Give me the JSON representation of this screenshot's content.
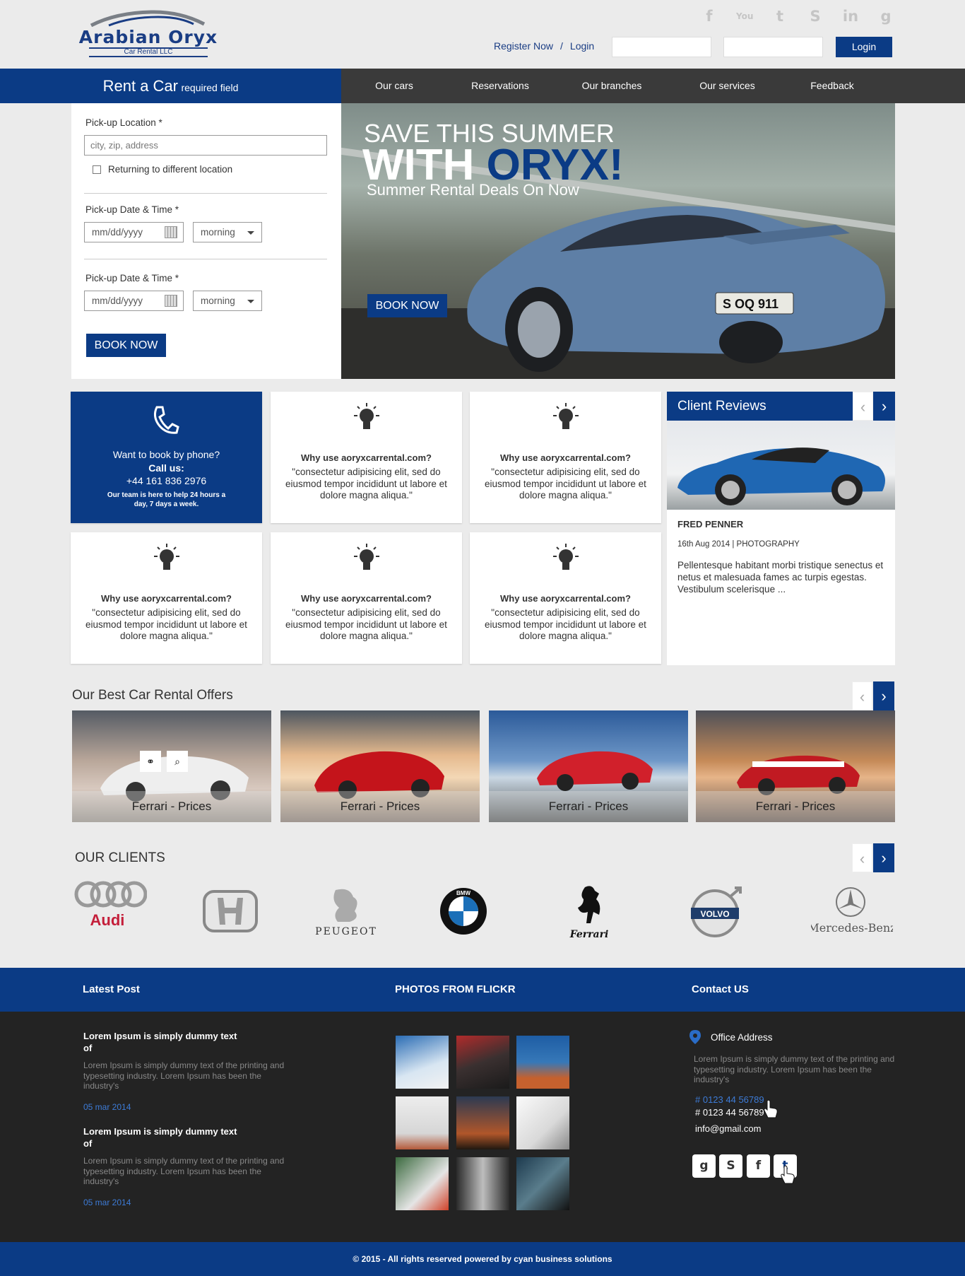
{
  "header": {
    "logo_name": "Arabian Oryx",
    "logo_sub": "Car Rental LLC",
    "social_icons": [
      "facebook-icon",
      "youtube-icon",
      "twitter-icon",
      "skype-icon",
      "linkedin-icon",
      "google-plus-icon"
    ],
    "register_label": "Register Now",
    "separator": "/",
    "login_link": "Login",
    "login_button": "Login"
  },
  "nav": {
    "rent_title": "Rent a Car",
    "rent_note": "required field",
    "items": [
      "Our cars",
      "Reservations",
      "Our branches",
      "Our services",
      "Feedback"
    ]
  },
  "form": {
    "pickup_location_label": "Pick-up Location *",
    "pickup_location_placeholder": "city, zip, address",
    "return_checkbox": "Returning to different location",
    "datetime_label_1": "Pick-up Date & Time *",
    "date_placeholder_1": "mm/dd/yyyy",
    "time_value_1": "morning",
    "datetime_label_2": "Pick-up Date & Time *",
    "date_placeholder_2": "mm/dd/yyyy",
    "time_value_2": "morning",
    "book_button": "BOOK NOW"
  },
  "hero": {
    "line1": "SAVE THIS SUMMER",
    "line2a": "WITH",
    "line2b": "ORYX!",
    "line3": "Summer Rental Deals On Now",
    "book_button": "BOOK NOW",
    "plate": "S OQ 911"
  },
  "phone_card": {
    "title": "Want to book by phone?",
    "call": "Call us:",
    "number": "+44 161 836 2976",
    "note": "Our team is here to help 24 hours a day, 7 days a week."
  },
  "features": [
    {
      "title": "Why use aoryxcarrental.com?",
      "quote": "\"consectetur adipisicing elit, sed do eiusmod tempor incididunt ut labore et dolore magna aliqua.\""
    },
    {
      "title": "Why use aoryxcarrental.com?",
      "quote": "\"consectetur adipisicing elit, sed do eiusmod tempor incididunt ut labore et dolore magna aliqua.\""
    },
    {
      "title": "Why use aoryxcarrental.com?",
      "quote": "\"consectetur adipisicing elit, sed do eiusmod tempor incididunt ut labore et dolore magna aliqua.\""
    },
    {
      "title": "Why use aoryxcarrental.com?",
      "quote": "\"consectetur adipisicing elit, sed do eiusmod tempor incididunt ut labore et dolore magna aliqua.\""
    },
    {
      "title": "Why use aoryxcarrental.com?",
      "quote": "\"consectetur adipisicing elit, sed do eiusmod tempor incididunt ut labore et dolore magna aliqua.\""
    }
  ],
  "reviews": {
    "title": "Client Reviews",
    "name": "FRED PENNER",
    "date": "16th Aug 2014 | PHOTOGRAPHY",
    "text": "Pellentesque habitant morbi tristique senectus et netus et malesuada fames ac turpis egestas. Vestibulum scelerisque ..."
  },
  "offers": {
    "title": "Our Best Car Rental Offers",
    "items": [
      "Ferrari - Prices",
      "Ferrari - Prices",
      "Ferrari - Prices",
      "Ferrari - Prices"
    ]
  },
  "clients": {
    "title": "OUR CLIENTS",
    "brands": [
      "Audi",
      "HONDA",
      "PEUGEOT",
      "BMW",
      "Ferrari",
      "VOLVO",
      "Mercedes-Benz"
    ]
  },
  "footer": {
    "latest_title": "Latest Post",
    "flickr_title": "PHOTOS FROM FLICKR",
    "contact_title": "Contact US",
    "posts": [
      {
        "title": "Lorem Ipsum is simply dummy text of",
        "text": "Lorem Ipsum is simply dummy text of the printing and typesetting industry. Lorem Ipsum has been the industry's",
        "date": "05 mar 2014"
      },
      {
        "title": "Lorem Ipsum is simply dummy text of",
        "text": "Lorem Ipsum is simply dummy text of the printing and typesetting industry. Lorem Ipsum has been the industry's",
        "date": "05 mar 2014"
      }
    ],
    "office_label": "Office Address",
    "office_text": "Lorem Ipsum is simply dummy text of the printing and typesetting industry. Lorem Ipsum has been the industry's",
    "phone1": "# 0123 44 56789",
    "phone2": "# 0123 44 56789",
    "email": "info@gmail.com",
    "social": [
      "google-plus-icon",
      "skype-icon",
      "facebook-icon",
      "twitter-icon"
    ],
    "copyright": "© 2015 - All rights reserved powered by cyan business solutions"
  },
  "colors": {
    "brand": "#0b3b85",
    "nav": "#3a3a3a",
    "footer": "#232323"
  }
}
